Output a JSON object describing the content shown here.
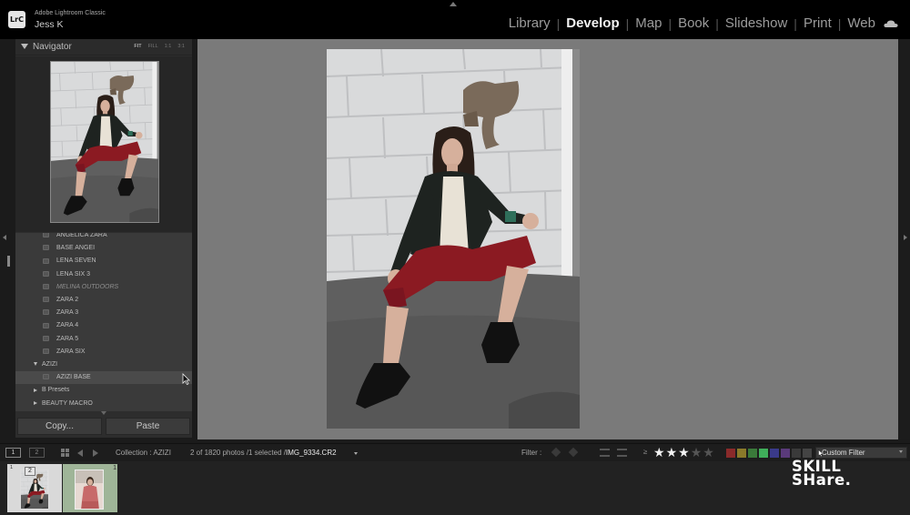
{
  "app": {
    "logo_text": "LrC",
    "app_name": "Adobe Lightroom Classic",
    "user_name": "Jess K"
  },
  "modules": [
    {
      "label": "Library",
      "active": false
    },
    {
      "label": "Develop",
      "active": true
    },
    {
      "label": "Map",
      "active": false
    },
    {
      "label": "Book",
      "active": false
    },
    {
      "label": "Slideshow",
      "active": false
    },
    {
      "label": "Print",
      "active": false
    },
    {
      "label": "Web",
      "active": false
    }
  ],
  "navigator": {
    "title": "Navigator",
    "options": [
      "FIT",
      "FILL",
      "1:1",
      "3:1"
    ],
    "active_option": "FIT"
  },
  "presets": {
    "items": [
      {
        "label": "ANGELICA ZARA",
        "kind": "preset"
      },
      {
        "label": "BASE ANGEI",
        "kind": "preset"
      },
      {
        "label": "LENA SEVEN",
        "kind": "preset"
      },
      {
        "label": "LENA SIX 3",
        "kind": "preset"
      },
      {
        "label": "MELINA OUTDOORS",
        "kind": "preset-italic"
      },
      {
        "label": "ZARA 2",
        "kind": "preset"
      },
      {
        "label": "ZARA 3",
        "kind": "preset"
      },
      {
        "label": "ZARA 4",
        "kind": "preset"
      },
      {
        "label": "ZARA 5",
        "kind": "preset"
      },
      {
        "label": "ZARA SIX",
        "kind": "preset"
      },
      {
        "label": "AZIZI",
        "kind": "folder-open"
      },
      {
        "label": "AZIZI BASE",
        "kind": "preset-selected"
      },
      {
        "label": "B Presets",
        "kind": "folder-closed"
      },
      {
        "label": "BEAUTY MACRO",
        "kind": "folder-closed"
      }
    ]
  },
  "buttons": {
    "copy": "Copy...",
    "paste": "Paste"
  },
  "toolbar": {
    "view1": "1",
    "view2": "2",
    "collection": "Collection : AZIZI",
    "count": "2 of 1820 photos /1 selected /",
    "filename": "IMG_9334.CR2",
    "filter_label": "Filter :",
    "rating_prefix": "≥",
    "rating": 3,
    "rating_max": 5,
    "custom_filter": "Custom Filter"
  },
  "color_labels": [
    "#8a2a2a",
    "#8a7a2a",
    "#3a7a3a",
    "#3fae5a",
    "#3a3a8a",
    "#5a3a7a",
    "#3a3a3a",
    "#444444"
  ],
  "filmstrip": {
    "cells": [
      {
        "index": "1",
        "badge": "2"
      },
      {
        "index": "",
        "badge": "1"
      }
    ]
  },
  "watermark": {
    "line1": "SKILL",
    "line2": "SHare."
  }
}
